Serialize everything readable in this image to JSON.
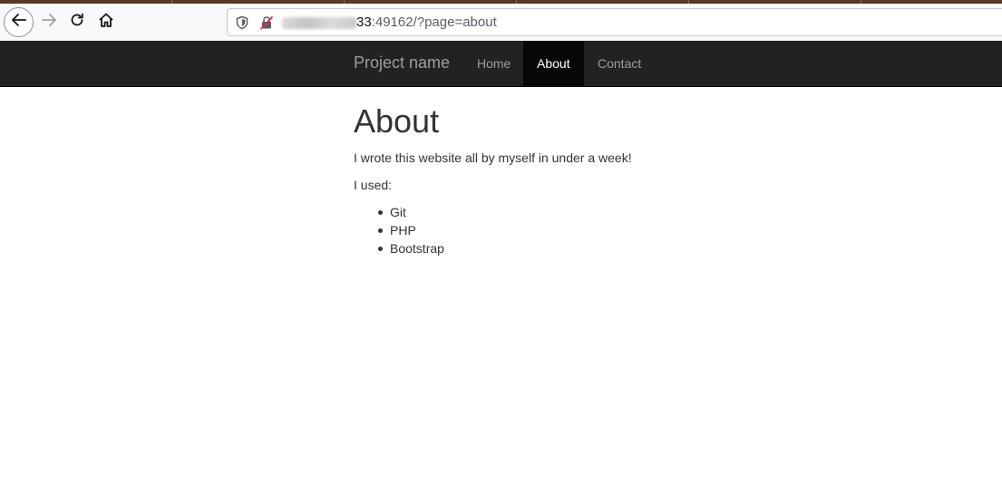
{
  "browser": {
    "url_host_visible": "33",
    "url_rest": ":49162/?page=about",
    "icons": {
      "back": "back-arrow-icon",
      "forward": "forward-arrow-icon",
      "reload": "reload-icon",
      "home": "home-icon",
      "shield": "tracking-shield-icon",
      "insecure": "insecure-lock-icon"
    }
  },
  "navbar": {
    "brand": "Project name",
    "items": [
      {
        "label": "Home",
        "active": false
      },
      {
        "label": "About",
        "active": true
      },
      {
        "label": "Contact",
        "active": false
      }
    ]
  },
  "main": {
    "title": "About",
    "intro": "I wrote this website all by myself in under a week!",
    "used_label": "I used:",
    "tools": [
      "Git",
      "PHP",
      "Bootstrap"
    ]
  },
  "colors": {
    "navbar_bg": "#222222",
    "navbar_active_bg": "#080808",
    "navbar_text": "#9d9d9d",
    "active_text": "#ffffff",
    "body_text": "#333333"
  }
}
